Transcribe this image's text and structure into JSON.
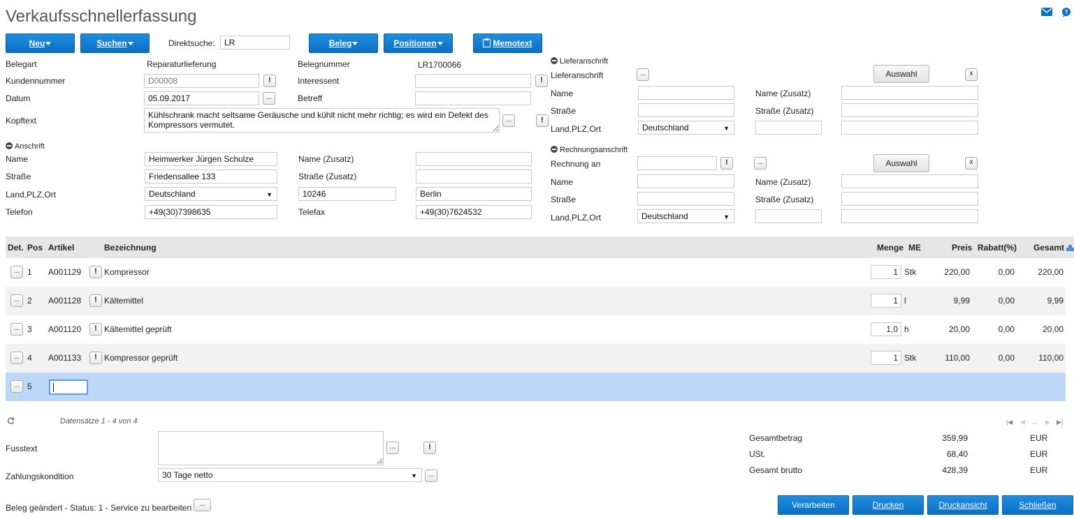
{
  "title": "Verkaufsschnellerfassung",
  "toolbar": {
    "neu": "Neu",
    "suchen": "Suchen",
    "direktsuche_label": "Direktsuche:",
    "direktsuche_value": "LR",
    "beleg": "Beleg",
    "positionen": "Positionen",
    "memotext": "Memotext"
  },
  "header": {
    "belegart_label": "Belegart",
    "belegart_value": "Reparaturlieferung",
    "belegnummer_label": "Belegnummer",
    "belegnummer_value": "LR1700066",
    "kundennummer_label": "Kundennummer",
    "kundennummer_value": "D00008",
    "interessent_label": "Interessent",
    "interessent_value": "",
    "datum_label": "Datum",
    "datum_value": "05.09.2017",
    "betreff_label": "Betreff",
    "betreff_value": "",
    "kopftext_label": "Kopftext",
    "kopftext_value": "Kühlschrank macht seltsame Geräusche und kühlt nicht mehr richtig; es wird ein Defekt des Kompressors vermutet."
  },
  "anschrift": {
    "section": "Anschrift",
    "name_label": "Name",
    "name_value": "Heimwerker Jürgen Schulze",
    "name_zusatz_label": "Name (Zusatz)",
    "name_zusatz_value": "",
    "strasse_label": "Straße",
    "strasse_value": "Friedensallee 133",
    "strasse_zusatz_label": "Straße (Zusatz)",
    "strasse_zusatz_value": "",
    "land_label": "Land,PLZ,Ort",
    "land_value": "Deutschland",
    "plz_value": "10246",
    "ort_value": "Berlin",
    "telefon_label": "Telefon",
    "telefon_value": "+49(30)7398635",
    "telefax_label": "Telefax",
    "telefax_value": "+49(30)7624532"
  },
  "lieferanschrift": {
    "section": "Lieferanschrift",
    "field_label": "Lieferanschrift",
    "auswahl": "Auswahl",
    "close": "x",
    "name_label": "Name",
    "name_zusatz_label": "Name (Zusatz)",
    "strasse_label": "Straße",
    "strasse_zusatz_label": "Straße (Zusatz)",
    "land_label": "Land,PLZ,Ort",
    "land_value": "Deutschland"
  },
  "rechnungsanschrift": {
    "section": "Rechnungsanschrift",
    "field_label": "Rechnung an",
    "auswahl": "Auswahl",
    "close": "x",
    "name_label": "Name",
    "name_zusatz_label": "Name (Zusatz)",
    "strasse_label": "Straße",
    "strasse_zusatz_label": "Straße (Zusatz)",
    "land_label": "Land,PLZ,Ort",
    "land_value": "Deutschland"
  },
  "grid": {
    "headers": {
      "det": "Det.",
      "pos": "Pos",
      "artikel": "Artikel",
      "bezeichnung": "Bezeichnung",
      "menge": "Menge",
      "me": "ME",
      "preis": "Preis",
      "rabatt": "Rabatt(%)",
      "gesamt": "Gesamt"
    },
    "rows": [
      {
        "pos": "1",
        "artikel": "A001129",
        "bezeichnung": "Kompressor",
        "menge": "1",
        "me": "Stk",
        "preis": "220,00",
        "rabatt": "0,00",
        "gesamt": "220,00"
      },
      {
        "pos": "2",
        "artikel": "A001128",
        "bezeichnung": "Kältemittel",
        "menge": "1",
        "me": "l",
        "preis": "9,99",
        "rabatt": "0,00",
        "gesamt": "9,99"
      },
      {
        "pos": "3",
        "artikel": "A001120",
        "bezeichnung": "Kältemittel geprüft",
        "menge": "1,0",
        "me": "h",
        "preis": "20,00",
        "rabatt": "0,00",
        "gesamt": "20,00"
      },
      {
        "pos": "4",
        "artikel": "A001133",
        "bezeichnung": "Kompressor geprüft",
        "menge": "1",
        "me": "Stk",
        "preis": "110,00",
        "rabatt": "0,00",
        "gesamt": "110,00"
      }
    ],
    "new_row_pos": "5",
    "datensaetze": "Datensätze 1 - 4 von 4",
    "pager_dots": "..."
  },
  "footer": {
    "fusstext_label": "Fusstext",
    "fusstext_value": "",
    "zahlung_label": "Zahlungskondition",
    "zahlung_value": "30 Tage netto",
    "status": "Beleg geändert - Status: 1 - Service zu bearbeiten"
  },
  "summary": {
    "gesamtbetrag_label": "Gesamtbetrag",
    "gesamtbetrag_value": "359,99",
    "ust_label": "USt.",
    "ust_value": "68,40",
    "brutto_label": "Gesamt brutto",
    "brutto_value": "428,39",
    "currency": "EUR"
  },
  "actions": {
    "verarbeiten": "Verarbeiten",
    "drucken": "Drucken",
    "druckansicht": "Druckansicht",
    "schliessen": "Schließen"
  },
  "colors": {
    "primary_button": "#0a70c4",
    "grid_header": "#e6e6e6",
    "row_alt": "#f2f2f2",
    "row_selected": "#bcd7f7"
  },
  "icons": {
    "mail": "mail-icon",
    "help": "help-chat-icon",
    "memo": "clipboard-icon",
    "refresh": "refresh-icon",
    "grid_settings": "grid-settings-icon"
  }
}
